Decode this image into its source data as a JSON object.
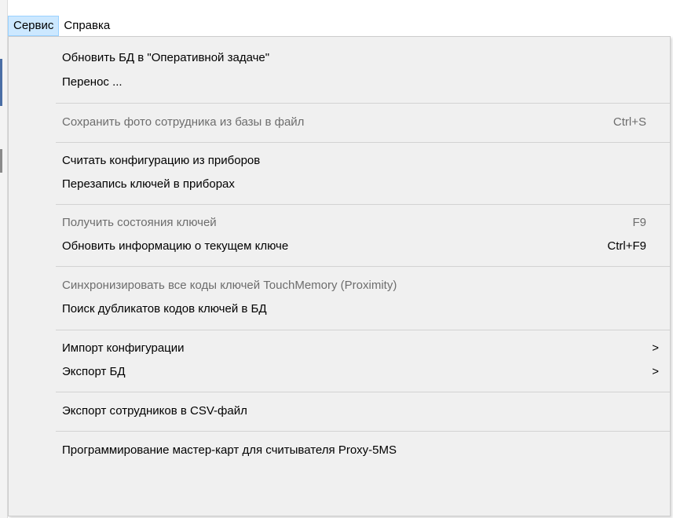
{
  "menubar": {
    "items": [
      {
        "label": "Сервис",
        "active": true
      },
      {
        "label": "Справка",
        "active": false
      }
    ]
  },
  "menu": {
    "items": [
      {
        "label": "Обновить БД в \"Оперативной задаче\"",
        "shortcut": "",
        "disabled": false,
        "submenu": false
      },
      {
        "label": "Перенос ...",
        "shortcut": "",
        "disabled": false,
        "submenu": false
      },
      {
        "label": "Сохранить фото сотрудника из базы в файл",
        "shortcut": "Ctrl+S",
        "disabled": true,
        "submenu": false
      },
      {
        "label": "Считать конфигурацию из приборов",
        "shortcut": "",
        "disabled": false,
        "submenu": false
      },
      {
        "label": "Перезапись ключей в приборах",
        "shortcut": "",
        "disabled": false,
        "submenu": false
      },
      {
        "label": "Получить состояния ключей",
        "shortcut": "F9",
        "disabled": true,
        "submenu": false
      },
      {
        "label": "Обновить информацию о текущем ключе",
        "shortcut": "Ctrl+F9",
        "disabled": false,
        "submenu": false
      },
      {
        "label": "Синхронизировать все коды ключей TouchMemory (Proximity)",
        "shortcut": "",
        "disabled": true,
        "submenu": false
      },
      {
        "label": "Поиск дубликатов кодов ключей в БД",
        "shortcut": "",
        "disabled": false,
        "submenu": false
      },
      {
        "label": "Импорт конфигурации",
        "shortcut": "",
        "disabled": false,
        "submenu": true
      },
      {
        "label": "Экспорт БД",
        "shortcut": "",
        "disabled": false,
        "submenu": true
      },
      {
        "label": "Экспорт сотрудников в CSV-файл",
        "shortcut": "",
        "disabled": false,
        "submenu": false
      },
      {
        "label": "Программирование мастер-карт для считывателя Proxy-5MS",
        "shortcut": "",
        "disabled": false,
        "submenu": false
      }
    ],
    "submenu_arrow": ">"
  },
  "colors": {
    "menu_background": "#f0f0f0",
    "active_menubar_background": "#cce8ff",
    "disabled_text": "#6d6d6d",
    "separator": "#d3d3d3"
  }
}
